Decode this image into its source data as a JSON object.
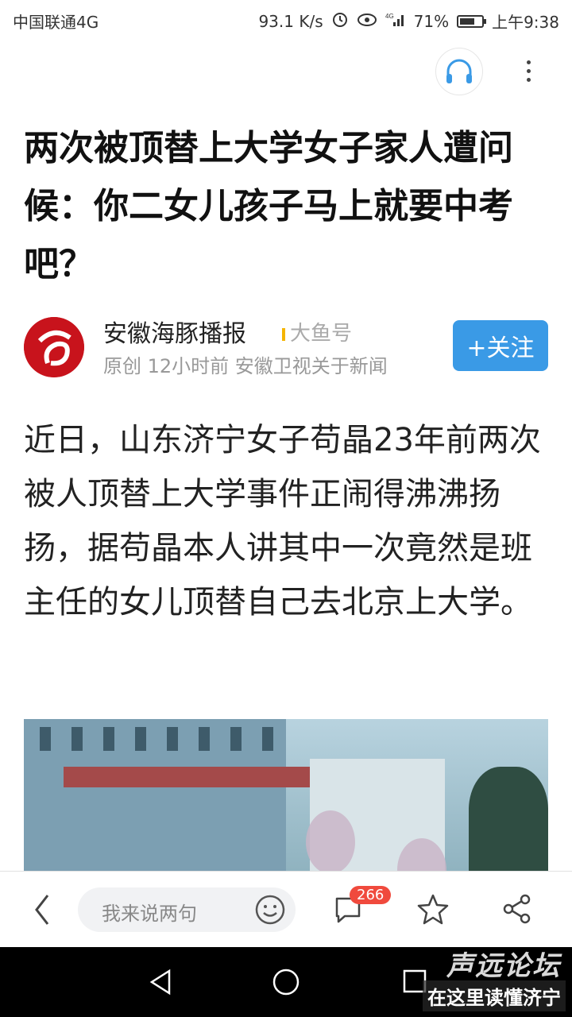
{
  "status_bar": {
    "carrier": "中国联通4G",
    "speed": "93.1 K/s",
    "battery": "71%",
    "battery_level": 0.71,
    "time": "上午9:38"
  },
  "article": {
    "title": "两次被顶替上大学女子家人遭问候：你二女儿孩子马上就要中考吧？",
    "author": {
      "name": "安徽海豚播报",
      "platform": "大鱼号",
      "meta": "原创  12小时前  安徽卫视关于新闻",
      "follow_label": "+关注"
    },
    "body": "近日，山东济宁女子苟晶23年前两次被人顶替上大学事件正闹得沸沸扬扬，据苟晶本人讲其中一次竟然是班主任的女儿顶替自己去北京上大学。"
  },
  "action_bar": {
    "comment_placeholder": "我来说两句",
    "comment_count": "266"
  },
  "watermark": {
    "line1": "声远论坛",
    "line2": "在这里读懂济宁"
  },
  "colors": {
    "accent": "#3a9ae6",
    "badge": "#f04a3d",
    "logo": "#c8131c"
  }
}
